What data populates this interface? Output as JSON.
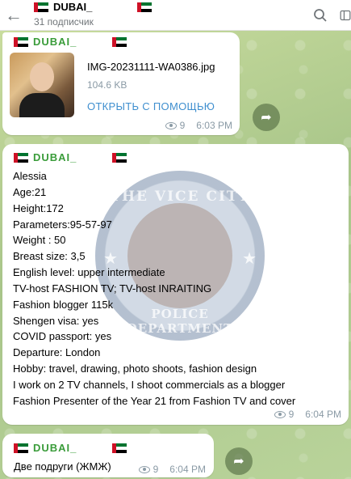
{
  "header": {
    "channel_name": "DUBAI_",
    "subscribers": "31 подписчик",
    "icons": {
      "back": "arrow-left-icon",
      "search": "search-icon",
      "side": "sidebar-toggle-icon"
    }
  },
  "messages": [
    {
      "sender": "DUBAI_",
      "file": {
        "name": "IMG-20231111-WA0386.jpg",
        "size": "104.6 KB",
        "open_with": "ОТКРЫТЬ С ПОМОЩЬЮ"
      },
      "views": "9",
      "time": "6:03 PM"
    },
    {
      "sender": "DUBAI_",
      "lines": [
        "Alessia",
        "Age:21",
        "Height:172",
        "Parameters:95-57-97",
        "Weight : 50",
        "Breast size: 3,5",
        "English level: upper intermediate",
        "TV-host FASHION TV; TV-host INRAITING",
        "Fashion blogger 115k",
        "Shengen visa: yes",
        "COVID passport: yes",
        "Departure: London",
        "Hobby: travel, drawing, photo shoots, fashion design",
        "I work on 2 TV channels, I shoot commercials as a blogger",
        "Fashion Presenter of the Year 21 from Fashion TV and cover"
      ],
      "watermark": {
        "top": "THE VICE CITY",
        "bottom": "POLICE DEPARTMENT"
      },
      "views": "9",
      "time": "6:04 PM"
    },
    {
      "sender": "DUBAI_",
      "text": "Две подруги (ЖМЖ)",
      "views": "9",
      "time": "6:04 PM"
    }
  ],
  "colors": {
    "sender": "#3a9c3a",
    "link": "#3f8fcf",
    "meta": "#8a9aa5",
    "flag_red": "#ce1126",
    "flag_green": "#00732f"
  }
}
